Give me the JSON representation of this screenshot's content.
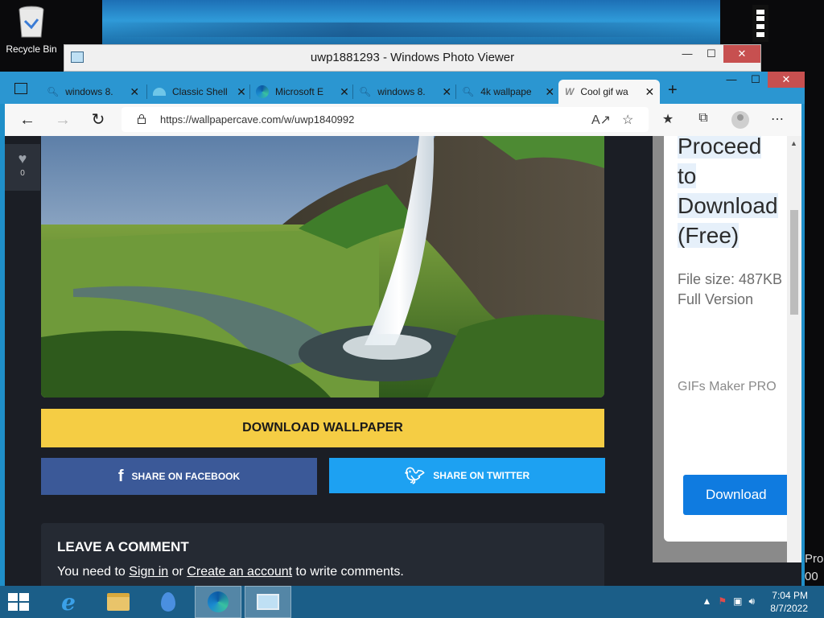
{
  "desktop": {
    "recycle_bin_label": "Recycle Bin",
    "overflow_text_1": "Pro",
    "overflow_text_2": "00"
  },
  "photo_viewer": {
    "title": "uwp1881293 - Windows Photo Viewer",
    "minimize": "—",
    "maximize": "☐",
    "close": "✕"
  },
  "browser": {
    "tabs": [
      {
        "title": "windows 8.",
        "icon": "search-icon",
        "active": false
      },
      {
        "title": "Classic Shell",
        "icon": "classic-shell-icon",
        "active": false
      },
      {
        "title": "Microsoft E",
        "icon": "edge-icon",
        "active": false
      },
      {
        "title": "windows 8.",
        "icon": "search-icon",
        "active": false
      },
      {
        "title": "4k wallpape",
        "icon": "search-icon",
        "active": false
      },
      {
        "title": "Cool gif wa",
        "icon": "wallpapercave-icon",
        "active": true
      }
    ],
    "tab_close": "✕",
    "new_tab": "+",
    "minimize": "—",
    "maximize": "☐",
    "close": "✕",
    "url": "https://wallpapercave.com/w/uwp1840992",
    "nav": {
      "back": "←",
      "forward": "→",
      "refresh": "↻"
    }
  },
  "page": {
    "like_count": "0",
    "download_label": "DOWNLOAD WALLPAPER",
    "share_facebook": "SHARE ON FACEBOOK",
    "share_twitter": "SHARE ON TWITTER",
    "comment_title": "LEAVE A COMMENT",
    "comment_prefix": "You need to ",
    "sign_in": "Sign in",
    "comment_or": " or ",
    "create_account": "Create an account",
    "comment_suffix": " to write comments."
  },
  "ad": {
    "headline_1": "Proceed",
    "headline_2": "to",
    "headline_3": "Download",
    "headline_4": "(Free)",
    "file_size": "File size: 487KB",
    "version": "Full Version",
    "maker": "GIFs Maker PRO",
    "download_button": "Download"
  },
  "taskbar": {
    "time": "7:04 PM",
    "date": "8/7/2022"
  },
  "colors": {
    "download_button": "#f5cd44",
    "facebook": "#3b5998",
    "twitter": "#1da1f2",
    "taskbar": "#1b5e88",
    "tabbar": "#2b96d1"
  }
}
